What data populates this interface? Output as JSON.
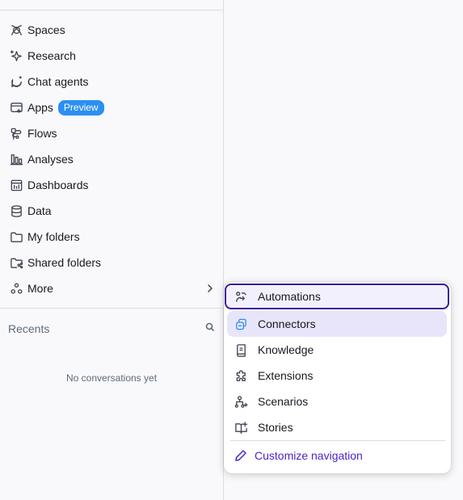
{
  "sidebar": {
    "items": [
      {
        "label": "Spaces",
        "icon": "spaces-icon"
      },
      {
        "label": "Research",
        "icon": "research-sparkle-icon"
      },
      {
        "label": "Chat agents",
        "icon": "chat-agent-icon"
      },
      {
        "label": "Apps",
        "icon": "apps-icon",
        "badge": "Preview"
      },
      {
        "label": "Flows",
        "icon": "flows-icon"
      },
      {
        "label": "Analyses",
        "icon": "analyses-icon"
      },
      {
        "label": "Dashboards",
        "icon": "dashboards-icon"
      },
      {
        "label": "Data",
        "icon": "database-icon"
      },
      {
        "label": "My folders",
        "icon": "folder-icon"
      },
      {
        "label": "Shared folders",
        "icon": "shared-folder-icon"
      },
      {
        "label": "More",
        "icon": "more-icon"
      }
    ]
  },
  "recents": {
    "title": "Recents",
    "empty_text": "No conversations yet"
  },
  "more_menu": {
    "items": [
      {
        "label": "Automations",
        "icon": "automations-icon"
      },
      {
        "label": "Connectors",
        "icon": "connectors-icon"
      },
      {
        "label": "Knowledge",
        "icon": "knowledge-icon"
      },
      {
        "label": "Extensions",
        "icon": "extensions-icon"
      },
      {
        "label": "Scenarios",
        "icon": "scenarios-icon"
      },
      {
        "label": "Stories",
        "icon": "stories-icon"
      }
    ],
    "customize_label": "Customize navigation"
  },
  "colors": {
    "badge": "#2b8ff3",
    "focus_ring": "#3a1d94",
    "link": "#4b23c9",
    "hover": "#e8e5fb"
  }
}
